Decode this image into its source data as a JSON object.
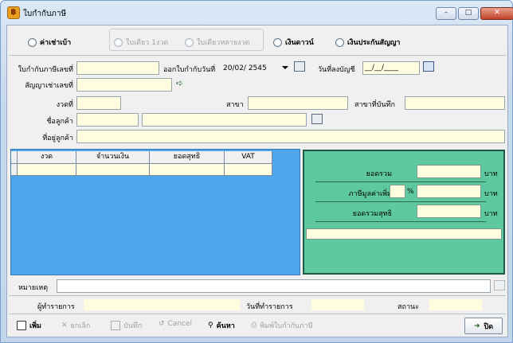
{
  "window": {
    "title": "ใบกำกับภาษี",
    "minimize_glyph": "–",
    "maximize_glyph": "□",
    "close_glyph": "✕"
  },
  "payment_types": {
    "hire_purchase": "ค่าเช่าเบ้า",
    "single_installment": "ใบเดียว 1งวด",
    "multi_installment": "ใบเดียวหลายงวด",
    "down_payment": "เงินดาวน์",
    "contract_deposit": "เงินประกันสัญญา"
  },
  "form": {
    "invoice_no_label": "ใบกำกับภาษีเลขที่",
    "issue_date_label": "ออกใบกำกับวันที่",
    "issue_date_value": "20/02/ 2545",
    "posting_date_label": "วันที่ลงบัญชี",
    "posting_date_value": "__/__/____",
    "contract_no_label": "สัญญาเช่าเลขที่",
    "installment_label": "งวดที่",
    "branch_label": "สาขา",
    "record_branch_label": "สาขาที่บันทึก",
    "customer_name_label": "ชื่อลูกค้า",
    "customer_address_label": "ที่อยู่ลูกค้า"
  },
  "grid": {
    "columns": [
      "งวด",
      "จำนวนเงิน",
      "ยอดสุทธิ",
      "VAT"
    ]
  },
  "totals": {
    "subtotal_label": "ยอดรวม",
    "vat_label": "ภาษีมูลค่าเพิ่ม",
    "percent_sign": "%",
    "net_total_label": "ยอดรวมสุทธิ",
    "currency": "บาท"
  },
  "note": {
    "label": "หมายเหตุ"
  },
  "info": {
    "operator_label": "ผู้ทำรายการ",
    "transaction_date_label": "วันที่ทำรายการ",
    "status_label": "สถานะ"
  },
  "toolbar": {
    "add": "เพิ่ม",
    "cancel_edit": "ยกเลิก",
    "save": "บันทึก",
    "cancel": "Cancel",
    "search": "ค้นหา",
    "print": "พิมพ์ใบกำกับภาษี",
    "exit": "ปิด"
  },
  "colors": {
    "input_bg": "#fffde0",
    "grid_bg": "#4da5ec",
    "totals_bg": "#5ec9a0"
  }
}
